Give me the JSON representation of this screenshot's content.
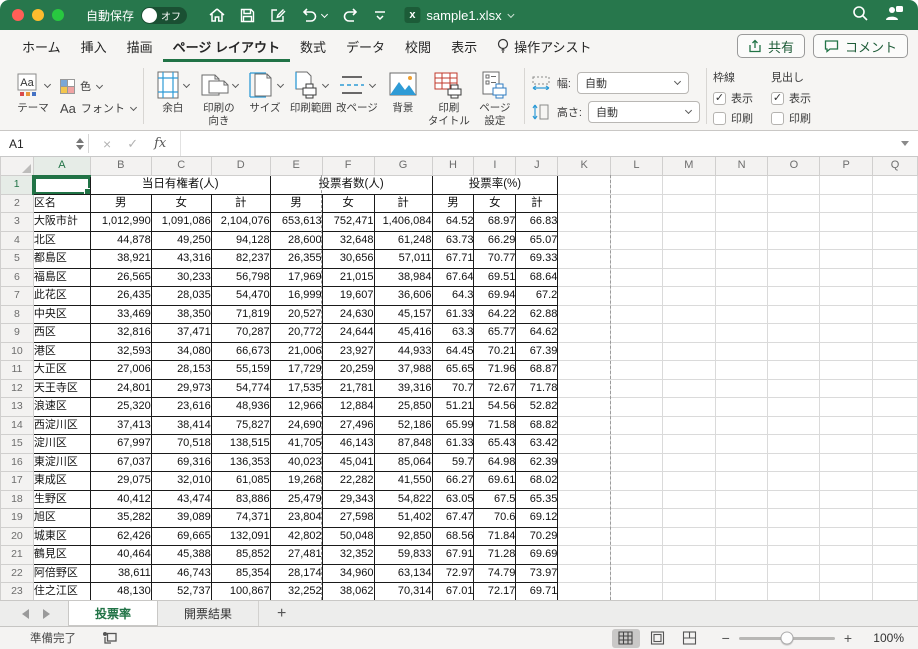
{
  "colors": {
    "titlebar_green": "#27774c",
    "accent_green": "#217346"
  },
  "titlebar": {
    "autosave_label": "自動保存",
    "autosave_state": "オフ",
    "filename": "sample1.xlsx"
  },
  "ribbon": {
    "tabs": [
      "ホーム",
      "挿入",
      "描画",
      "ページ レイアウト",
      "数式",
      "データ",
      "校閲",
      "表示",
      "操作アシスト"
    ],
    "active_tab": "ページ レイアウト",
    "share_label": "共有",
    "comments_label": "コメント",
    "buttons": {
      "themes": "テーマ",
      "colors": "色",
      "fonts": "フォント",
      "margins": "余白",
      "orientation": "印刷の\n向き",
      "size": "サイズ",
      "print_area": "印刷範囲",
      "page_breaks": "改ページ",
      "background": "背景",
      "print_titles": "印刷\nタイトル",
      "page_setup": "ページ\n設定"
    },
    "scale": {
      "width_label": "幅:",
      "width_value": "自動",
      "height_label": "高さ:",
      "height_value": "自動"
    },
    "sheet_options": {
      "gridlines_label": "枠線",
      "headings_label": "見出し",
      "view_label": "表示",
      "print_label": "印刷",
      "gridlines_view_checked": true,
      "gridlines_print_checked": false,
      "headings_view_checked": true,
      "headings_print_checked": false
    }
  },
  "formula_bar": {
    "name_box": "A1",
    "formula": "",
    "fx_label": "fx"
  },
  "grid": {
    "columns": [
      "A",
      "B",
      "C",
      "D",
      "E",
      "F",
      "G",
      "H",
      "I",
      "J",
      "K",
      "L",
      "M",
      "N",
      "O",
      "P",
      "Q"
    ],
    "selected_cell": "A1",
    "merged_headers": [
      "当日有権者(人)",
      "投票者数(人)",
      "投票率(%)"
    ],
    "sub_headers": [
      "区名",
      "男",
      "女",
      "計",
      "男",
      "女",
      "計",
      "男",
      "女",
      "計"
    ],
    "data_rows": [
      [
        "大阪市計",
        "1,012,990",
        "1,091,086",
        "2,104,076",
        "653,613",
        "752,471",
        "1,406,084",
        "64.52",
        "68.97",
        "66.83"
      ],
      [
        "北区",
        "44,878",
        "49,250",
        "94,128",
        "28,600",
        "32,648",
        "61,248",
        "63.73",
        "66.29",
        "65.07"
      ],
      [
        "都島区",
        "38,921",
        "43,316",
        "82,237",
        "26,355",
        "30,656",
        "57,011",
        "67.71",
        "70.77",
        "69.33"
      ],
      [
        "福島区",
        "26,565",
        "30,233",
        "56,798",
        "17,969",
        "21,015",
        "38,984",
        "67.64",
        "69.51",
        "68.64"
      ],
      [
        "此花区",
        "26,435",
        "28,035",
        "54,470",
        "16,999",
        "19,607",
        "36,606",
        "64.3",
        "69.94",
        "67.2"
      ],
      [
        "中央区",
        "33,469",
        "38,350",
        "71,819",
        "20,527",
        "24,630",
        "45,157",
        "61.33",
        "64.22",
        "62.88"
      ],
      [
        "西区",
        "32,816",
        "37,471",
        "70,287",
        "20,772",
        "24,644",
        "45,416",
        "63.3",
        "65.77",
        "64.62"
      ],
      [
        "港区",
        "32,593",
        "34,080",
        "66,673",
        "21,006",
        "23,927",
        "44,933",
        "64.45",
        "70.21",
        "67.39"
      ],
      [
        "大正区",
        "27,006",
        "28,153",
        "55,159",
        "17,729",
        "20,259",
        "37,988",
        "65.65",
        "71.96",
        "68.87"
      ],
      [
        "天王寺区",
        "24,801",
        "29,973",
        "54,774",
        "17,535",
        "21,781",
        "39,316",
        "70.7",
        "72.67",
        "71.78"
      ],
      [
        "浪速区",
        "25,320",
        "23,616",
        "48,936",
        "12,966",
        "12,884",
        "25,850",
        "51.21",
        "54.56",
        "52.82"
      ],
      [
        "西淀川区",
        "37,413",
        "38,414",
        "75,827",
        "24,690",
        "27,496",
        "52,186",
        "65.99",
        "71.58",
        "68.82"
      ],
      [
        "淀川区",
        "67,997",
        "70,518",
        "138,515",
        "41,705",
        "46,143",
        "87,848",
        "61.33",
        "65.43",
        "63.42"
      ],
      [
        "東淀川区",
        "67,037",
        "69,316",
        "136,353",
        "40,023",
        "45,041",
        "85,064",
        "59.7",
        "64.98",
        "62.39"
      ],
      [
        "東成区",
        "29,075",
        "32,010",
        "61,085",
        "19,268",
        "22,282",
        "41,550",
        "66.27",
        "69.61",
        "68.02"
      ],
      [
        "生野区",
        "40,412",
        "43,474",
        "83,886",
        "25,479",
        "29,343",
        "54,822",
        "63.05",
        "67.5",
        "65.35"
      ],
      [
        "旭区",
        "35,282",
        "39,089",
        "74,371",
        "23,804",
        "27,598",
        "51,402",
        "67.47",
        "70.6",
        "69.12"
      ],
      [
        "城東区",
        "62,426",
        "69,665",
        "132,091",
        "42,802",
        "50,048",
        "92,850",
        "68.56",
        "71.84",
        "70.29"
      ],
      [
        "鶴見区",
        "40,464",
        "45,388",
        "85,852",
        "27,481",
        "32,352",
        "59,833",
        "67.91",
        "71.28",
        "69.69"
      ],
      [
        "阿倍野区",
        "38,611",
        "46,743",
        "85,354",
        "28,174",
        "34,960",
        "63,134",
        "72.97",
        "74.79",
        "73.97"
      ],
      [
        "住之江区",
        "48,130",
        "52,737",
        "100,867",
        "32,252",
        "38,062",
        "70,314",
        "67.01",
        "72.17",
        "69.71"
      ]
    ]
  },
  "sheet_tabs": {
    "tabs": [
      "投票率",
      "開票結果"
    ],
    "active": "投票率",
    "add_label": "+"
  },
  "status_bar": {
    "ready": "準備完了",
    "zoom_percent": "100%"
  }
}
